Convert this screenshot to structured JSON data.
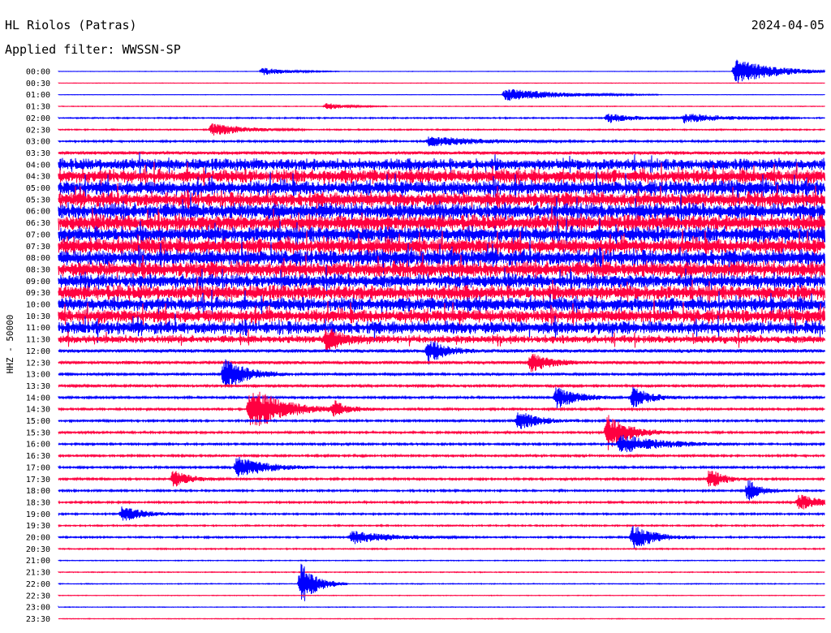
{
  "header": {
    "station": "HL Riolos (Patras)",
    "date": "2024-04-05",
    "filter": "Applied filter: WWSSN-SP"
  },
  "chart_data": {
    "type": "line",
    "title": "HL Riolos (Patras)",
    "subtitle": "Applied filter: WWSSN-SP",
    "date": "2024-04-05",
    "ylabel": "HHZ - 50000",
    "row_labels": [
      "00:00",
      "00:30",
      "01:00",
      "01:30",
      "02:00",
      "02:30",
      "03:00",
      "03:30",
      "04:00",
      "04:30",
      "05:00",
      "05:30",
      "06:00",
      "06:30",
      "07:00",
      "07:30",
      "08:00",
      "08:30",
      "09:00",
      "09:30",
      "10:00",
      "10:30",
      "11:00",
      "11:30",
      "12:00",
      "12:30",
      "13:00",
      "13:30",
      "14:00",
      "14:30",
      "15:00",
      "15:30",
      "16:00",
      "16:30",
      "17:00",
      "17:30",
      "18:00",
      "18:30",
      "19:00",
      "19:30",
      "20:00",
      "20:30",
      "21:00",
      "21:30",
      "22:00",
      "22:30",
      "23:00",
      "23:30"
    ],
    "trace_colors": [
      "#0000ff",
      "#ff0040"
    ],
    "noise_level": [
      0.2,
      0.2,
      0.2,
      0.3,
      0.6,
      0.6,
      0.9,
      1.6,
      6,
      7,
      7.5,
      7.5,
      8,
      8,
      8,
      8,
      8,
      8,
      7,
      7.5,
      7,
      7,
      6.5,
      4,
      1.8,
      1.5,
      1.2,
      1.2,
      1.1,
      1,
      1,
      1,
      1,
      1,
      1,
      1,
      0.9,
      0.9,
      0.8,
      0.7,
      0.8,
      0.6,
      0.4,
      0.4,
      0.4,
      0.3,
      0.3,
      0.3
    ],
    "events": [
      {
        "row": 0,
        "minute": 8,
        "amp": 5,
        "dur": 1
      },
      {
        "row": 0,
        "minute": 26.5,
        "amp": 16,
        "dur": 1.5
      },
      {
        "row": 2,
        "minute": 17.5,
        "amp": 8,
        "dur": 2
      },
      {
        "row": 3,
        "minute": 10.5,
        "amp": 4,
        "dur": 0.8
      },
      {
        "row": 4,
        "minute": 21.5,
        "amp": 6,
        "dur": 1
      },
      {
        "row": 4,
        "minute": 24.5,
        "amp": 6,
        "dur": 1.5
      },
      {
        "row": 5,
        "minute": 6,
        "amp": 8,
        "dur": 1.2
      },
      {
        "row": 6,
        "minute": 14.5,
        "amp": 6,
        "dur": 2
      },
      {
        "row": 23,
        "minute": 10.5,
        "amp": 12,
        "dur": 0.6
      },
      {
        "row": 24,
        "minute": 14.5,
        "amp": 16,
        "dur": 0.6
      },
      {
        "row": 25,
        "minute": 18.5,
        "amp": 12,
        "dur": 0.8
      },
      {
        "row": 26,
        "minute": 6.5,
        "amp": 22,
        "dur": 0.8
      },
      {
        "row": 28,
        "minute": 19.5,
        "amp": 14,
        "dur": 0.8
      },
      {
        "row": 28,
        "minute": 22.5,
        "amp": 14,
        "dur": 0.6
      },
      {
        "row": 29,
        "minute": 7.5,
        "amp": 30,
        "dur": 1.2
      },
      {
        "row": 29,
        "minute": 10.8,
        "amp": 10,
        "dur": 0.6
      },
      {
        "row": 30,
        "minute": 18,
        "amp": 12,
        "dur": 0.8
      },
      {
        "row": 31,
        "minute": 21.5,
        "amp": 22,
        "dur": 0.8
      },
      {
        "row": 32,
        "minute": 22,
        "amp": 12,
        "dur": 1.5
      },
      {
        "row": 34,
        "minute": 7,
        "amp": 14,
        "dur": 1
      },
      {
        "row": 35,
        "minute": 4.5,
        "amp": 12,
        "dur": 0.6
      },
      {
        "row": 35,
        "minute": 25.5,
        "amp": 14,
        "dur": 0.5
      },
      {
        "row": 36,
        "minute": 27,
        "amp": 14,
        "dur": 0.5
      },
      {
        "row": 37,
        "minute": 29,
        "amp": 10,
        "dur": 0.8
      },
      {
        "row": 38,
        "minute": 2.5,
        "amp": 10,
        "dur": 0.8
      },
      {
        "row": 40,
        "minute": 11.5,
        "amp": 8,
        "dur": 1.5
      },
      {
        "row": 40,
        "minute": 22.5,
        "amp": 16,
        "dur": 0.8
      },
      {
        "row": 44,
        "minute": 9.5,
        "amp": 26,
        "dur": 0.6
      }
    ]
  }
}
